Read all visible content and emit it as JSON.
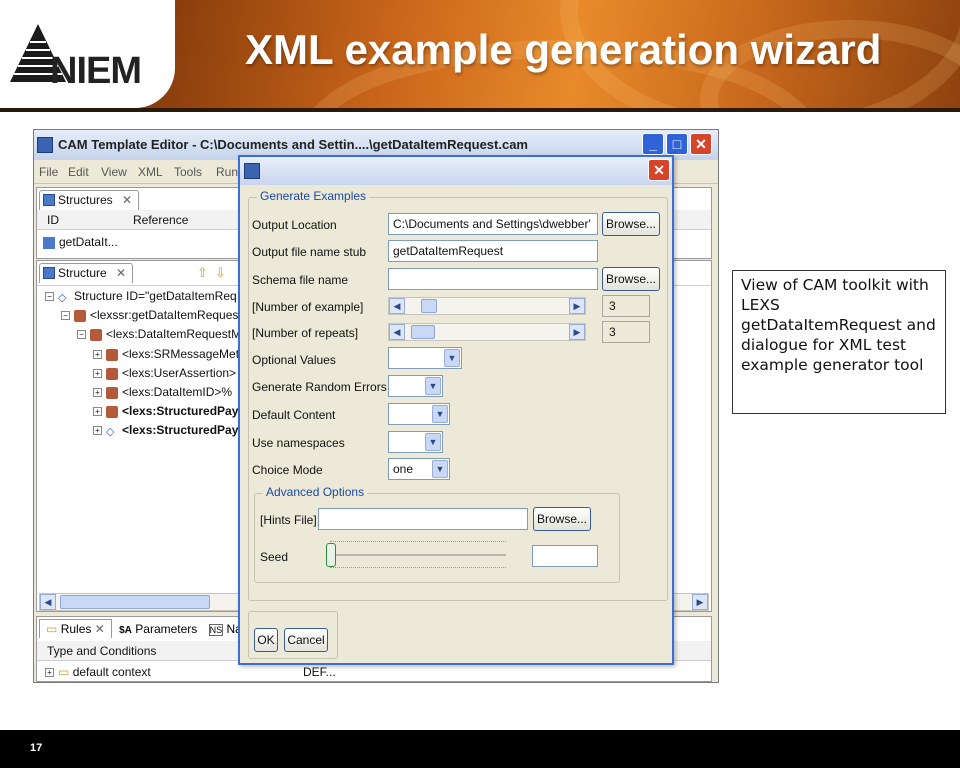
{
  "slide": {
    "title": "XML example generation wizard",
    "logo_text": "NIEM",
    "page_number": "17",
    "note_text": "View of CAM toolkit with LEXS getDataItemRequest and dialogue for XML test example generator tool"
  },
  "editor": {
    "title": "CAM Template Editor - C:\\Documents and Settin....\\getDataItemRequest.cam",
    "menu": [
      "File",
      "Edit",
      "View",
      "XML",
      "Tools",
      "Run"
    ],
    "structures_tab": "Structures",
    "structures_cols": [
      "ID",
      "Reference"
    ],
    "structures_row": "getDataIt...",
    "structure_tab": "Structure",
    "tree": [
      {
        "text": "Structure ID=\"getDataItemReq",
        "bold": false
      },
      {
        "text": "<lexssr:getDataItemReques",
        "bold": false
      },
      {
        "text": "<lexs:DataItemRequestM",
        "bold": false
      },
      {
        "text": "<lexs:SRMessageMeta",
        "bold": false
      },
      {
        "text": "<lexs:UserAssertion>",
        "bold": false
      },
      {
        "text": "<lexs:DataItemID>%",
        "bold": false
      },
      {
        "text": "<lexs:StructuredPay",
        "bold": true
      },
      {
        "text": "<lexs:StructuredPay",
        "bold": true
      }
    ],
    "bottom_tabs": [
      "Rules",
      "Parameters",
      "Name"
    ],
    "rules_header": "Type and Conditions",
    "rules_row": "default context",
    "rules_row_value": "DEF..."
  },
  "dialog": {
    "group_generate": "Generate Examples",
    "output_location_label": "Output Location",
    "output_location_value": "C:\\Documents and Settings\\dwebber'",
    "browse_label": "Browse...",
    "file_stub_label": "Output file name stub",
    "file_stub_value": "getDataItemRequest",
    "schema_label": "Schema file name",
    "schema_value": "",
    "num_examples_label": "[Number of example]",
    "num_examples_value": "3",
    "num_repeats_label": "[Number of repeats]",
    "num_repeats_value": "3",
    "optional_values_label": "Optional Values",
    "optional_values_value": "",
    "random_errors_label": "Generate Random Errors",
    "random_errors_value": "",
    "default_content_label": "Default Content",
    "default_content_value": "",
    "namespaces_label": "Use namespaces",
    "namespaces_value": "",
    "choice_mode_label": "Choice Mode",
    "choice_mode_value": "one",
    "group_advanced": "Advanced Options",
    "hints_label": "[Hints File]",
    "hints_value": "",
    "seed_label": "Seed",
    "seed_value": "",
    "ok_label": "OK",
    "cancel_label": "Cancel"
  }
}
